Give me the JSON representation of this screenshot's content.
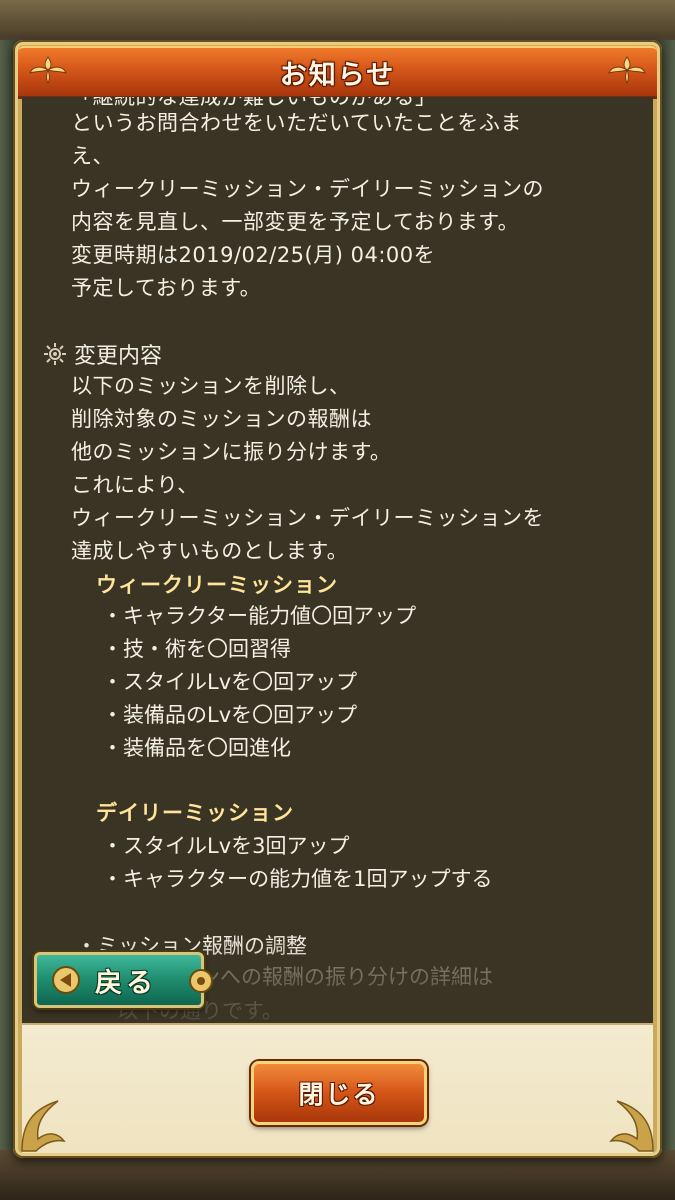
{
  "dialog": {
    "title": "お知らせ"
  },
  "content": {
    "cut_line": "「継続的な達成が難しいものがある」",
    "intro_lines": [
      "というお問合わせをいただいていたことをふま",
      "え、",
      "ウィークリーミッション・デイリーミッションの",
      "内容を見直し、一部変更を予定しております。",
      "変更時期は2019/02/25(月) 04:00を",
      "予定しております。"
    ],
    "section_title": "変更内容",
    "section_lines": [
      "以下のミッションを削除し、",
      "削除対象のミッションの報酬は",
      "他のミッションに振り分けます。",
      "これにより、",
      "ウィークリーミッション・デイリーミッションを",
      "達成しやすいものとします。"
    ],
    "weekly_title": "ウィークリーミッション",
    "weekly_items": [
      "キャラクター能力値〇回アップ",
      "技・術を〇回習得",
      "スタイルLvを〇回アップ",
      "装備品のLvを〇回アップ",
      "装備品を〇回進化"
    ],
    "daily_title": "デイリーミッション",
    "daily_items": [
      "スタイルLvを3回アップ",
      "キャラクターの能力値を1回アップする"
    ],
    "adjust_title": "・ミッション報酬の調整",
    "faded_lines": [
      "ンへの報酬の振り分けの詳細は",
      "以下の通りです。"
    ]
  },
  "buttons": {
    "back_label": "戻る",
    "close_label": "閉じる"
  },
  "colors": {
    "title_bar": "#d4561a",
    "content_bg": "#3a3424",
    "subhead": "#ffe49a",
    "back_button": "#1f8c6e",
    "close_button": "#d45518",
    "footer_bg": "#f3ead0"
  },
  "icons": {
    "section_bullet": "sun-gear-icon",
    "title_ornaments": "fleur-ornament-icon",
    "back_arrow": "arrow-left-icon"
  }
}
